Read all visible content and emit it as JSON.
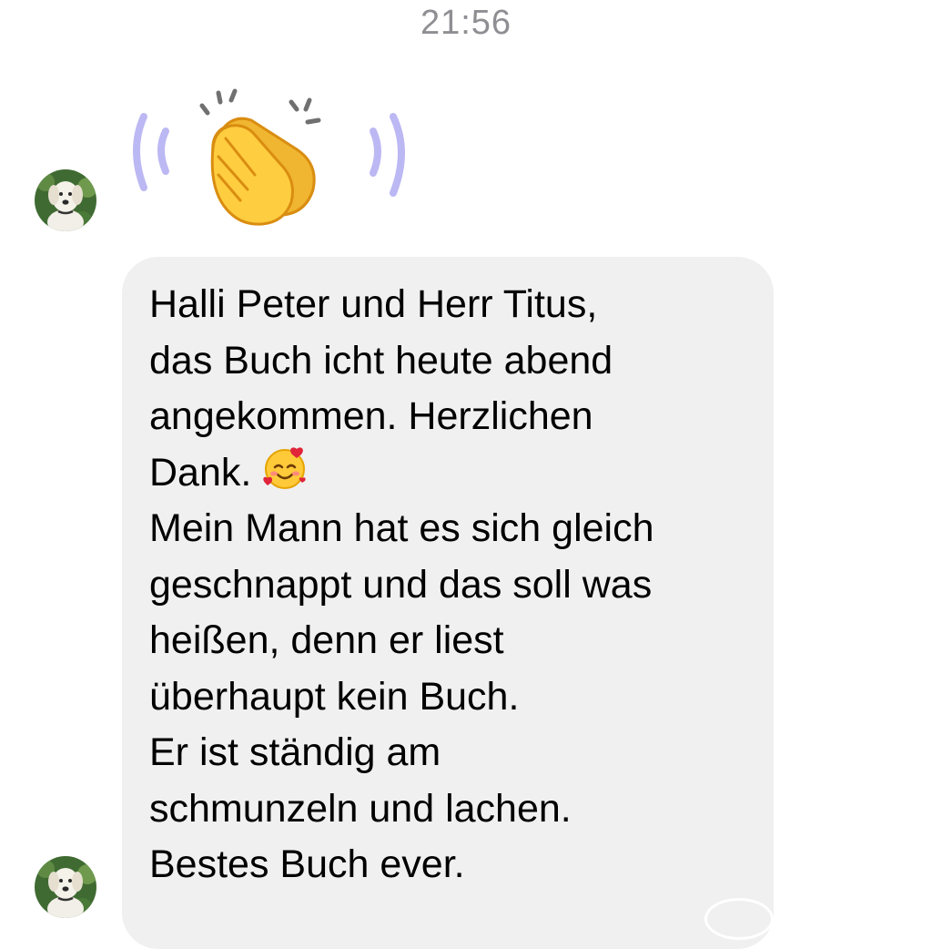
{
  "header": {
    "timestamp": "21:56"
  },
  "conversation": {
    "messages": [
      {
        "type": "emoji-reaction",
        "emoji": "👏",
        "icon": "clapping-hands-icon",
        "avatar": "dog-avatar"
      },
      {
        "type": "text",
        "avatar": "dog-avatar",
        "lines": [
          "Halli Peter und Herr Titus,",
          "das Buch icht heute abend",
          "angekommen. Herzlichen",
          "Dank.",
          "Mein Mann hat es sich gleich",
          "geschnappt und das soll was",
          "heißen, denn er liest",
          "überhaupt kein Buch.",
          "Er ist ständig am",
          "schmunzeln und lachen.",
          "Bestes Buch ever."
        ],
        "inline_emoji": "smiling-face-with-hearts-icon"
      }
    ]
  },
  "colors": {
    "bubble_background": "#f0f0f1",
    "timestamp": "#8e8e93",
    "reaction_waves": "#bcb8f4"
  }
}
